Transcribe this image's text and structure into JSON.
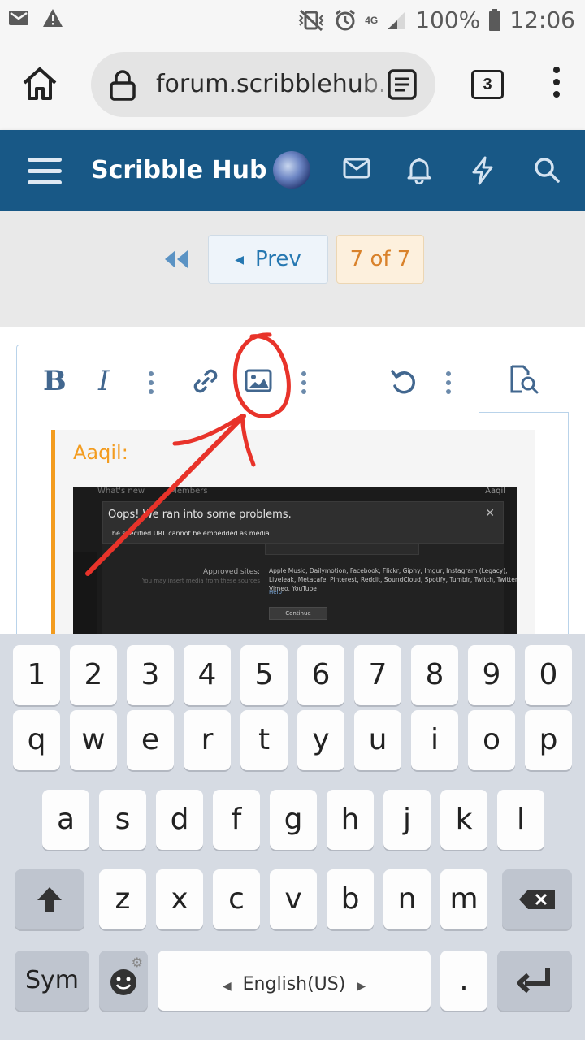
{
  "status_bar": {
    "battery": "100%",
    "time": "12:06",
    "network": "4G"
  },
  "browser": {
    "url": "forum.scribblehub.c",
    "tab_count": "3"
  },
  "site": {
    "title": "Scribble Hub"
  },
  "pagination": {
    "prev_label": "Prev",
    "current": "7 of 7"
  },
  "editor": {
    "toolbar": {
      "bold": "B",
      "italic": "I"
    },
    "quote": {
      "author": "Aaqil:",
      "embedded_screenshot": {
        "nav": [
          "What's new",
          "Members"
        ],
        "user": "Aaqil",
        "error_title": "Oops! We ran into some problems.",
        "error_message": "The specified URL cannot be embedded as media.",
        "approved_label": "Approved sites:",
        "approved_hint": "You may insert media from these sources",
        "approved_sites": "Apple Music, Dailymotion, Facebook, Flickr, Giphy, Imgur, Instagram (Legacy), Liveleak, Metacafe, Pinterest, Reddit, SoundCloud, Spotify, Tumblr, Twitch, Twitter, Vimeo, YouTube",
        "help": "Help",
        "continue": "Continue"
      }
    }
  },
  "annotation_color": "#e8332a",
  "keyboard": {
    "row_numbers": [
      "1",
      "2",
      "3",
      "4",
      "5",
      "6",
      "7",
      "8",
      "9",
      "0"
    ],
    "row_1": [
      "q",
      "w",
      "e",
      "r",
      "t",
      "y",
      "u",
      "i",
      "o",
      "p"
    ],
    "row_2": [
      "a",
      "s",
      "d",
      "f",
      "g",
      "h",
      "j",
      "k",
      "l"
    ],
    "row_3": [
      "z",
      "x",
      "c",
      "v",
      "b",
      "n",
      "m"
    ],
    "sym": "Sym",
    "space_label": "English(US)",
    "period": "."
  }
}
